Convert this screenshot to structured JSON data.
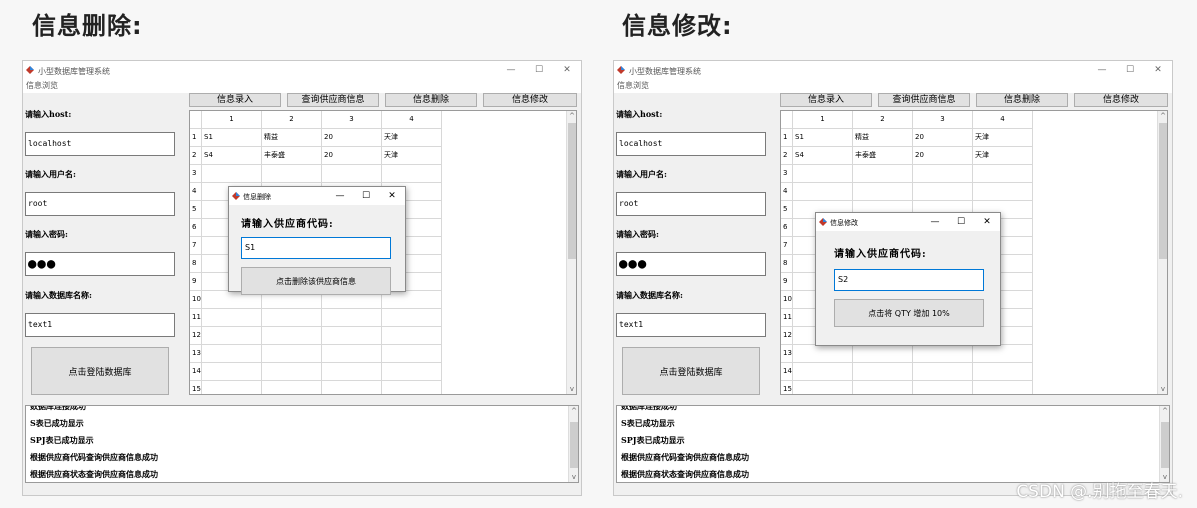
{
  "headings": {
    "left": "信息删除:",
    "right": "信息修改:"
  },
  "app": {
    "title": "小型数据库管理系统",
    "menu": "信息浏览",
    "window_controls": {
      "min": "—",
      "max": "☐",
      "close": "✕"
    }
  },
  "form": {
    "host_label": "请输入host:",
    "host_value": "localhost",
    "user_label": "请输入用户名:",
    "user_value": "root",
    "pwd_label": "请输入密码:",
    "pwd_value": "●●●",
    "db_label": "请输入数据库名称:",
    "db_value": "text1",
    "login_button": "点击登陆数据库"
  },
  "toolbar": [
    "信息录入",
    "查询供应商信息",
    "信息删除",
    "信息修改"
  ],
  "table": {
    "columns": [
      "1",
      "2",
      "3",
      "4"
    ],
    "row_numbers": [
      "1",
      "2",
      "3",
      "4",
      "5",
      "6",
      "7",
      "8",
      "9",
      "10",
      "11",
      "12",
      "13",
      "14",
      "15"
    ],
    "rows": [
      [
        "S1",
        "精益",
        "20",
        "天津"
      ],
      [
        "S4",
        "丰泰盛",
        "20",
        "天津"
      ]
    ]
  },
  "log": {
    "lines": [
      "数据库连接成功",
      "S表已成功显示",
      "SPJ表已成功显示",
      "根据供应商代码查询供应商信息成功",
      "根据供应商状态查询供应商信息成功"
    ]
  },
  "dialog_delete": {
    "title": "信息删除",
    "prompt": "请输入供应商代码:",
    "input_value": "S1",
    "button": "点击删除该供应商信息"
  },
  "dialog_modify": {
    "title": "信息修改",
    "prompt": "请输入供应商代码:",
    "input_value": "S2",
    "button": "点击将 QTY 增加 10%"
  },
  "scroll": {
    "up": "^",
    "down": "v"
  },
  "watermark": "CSDN @.别拖至春天."
}
